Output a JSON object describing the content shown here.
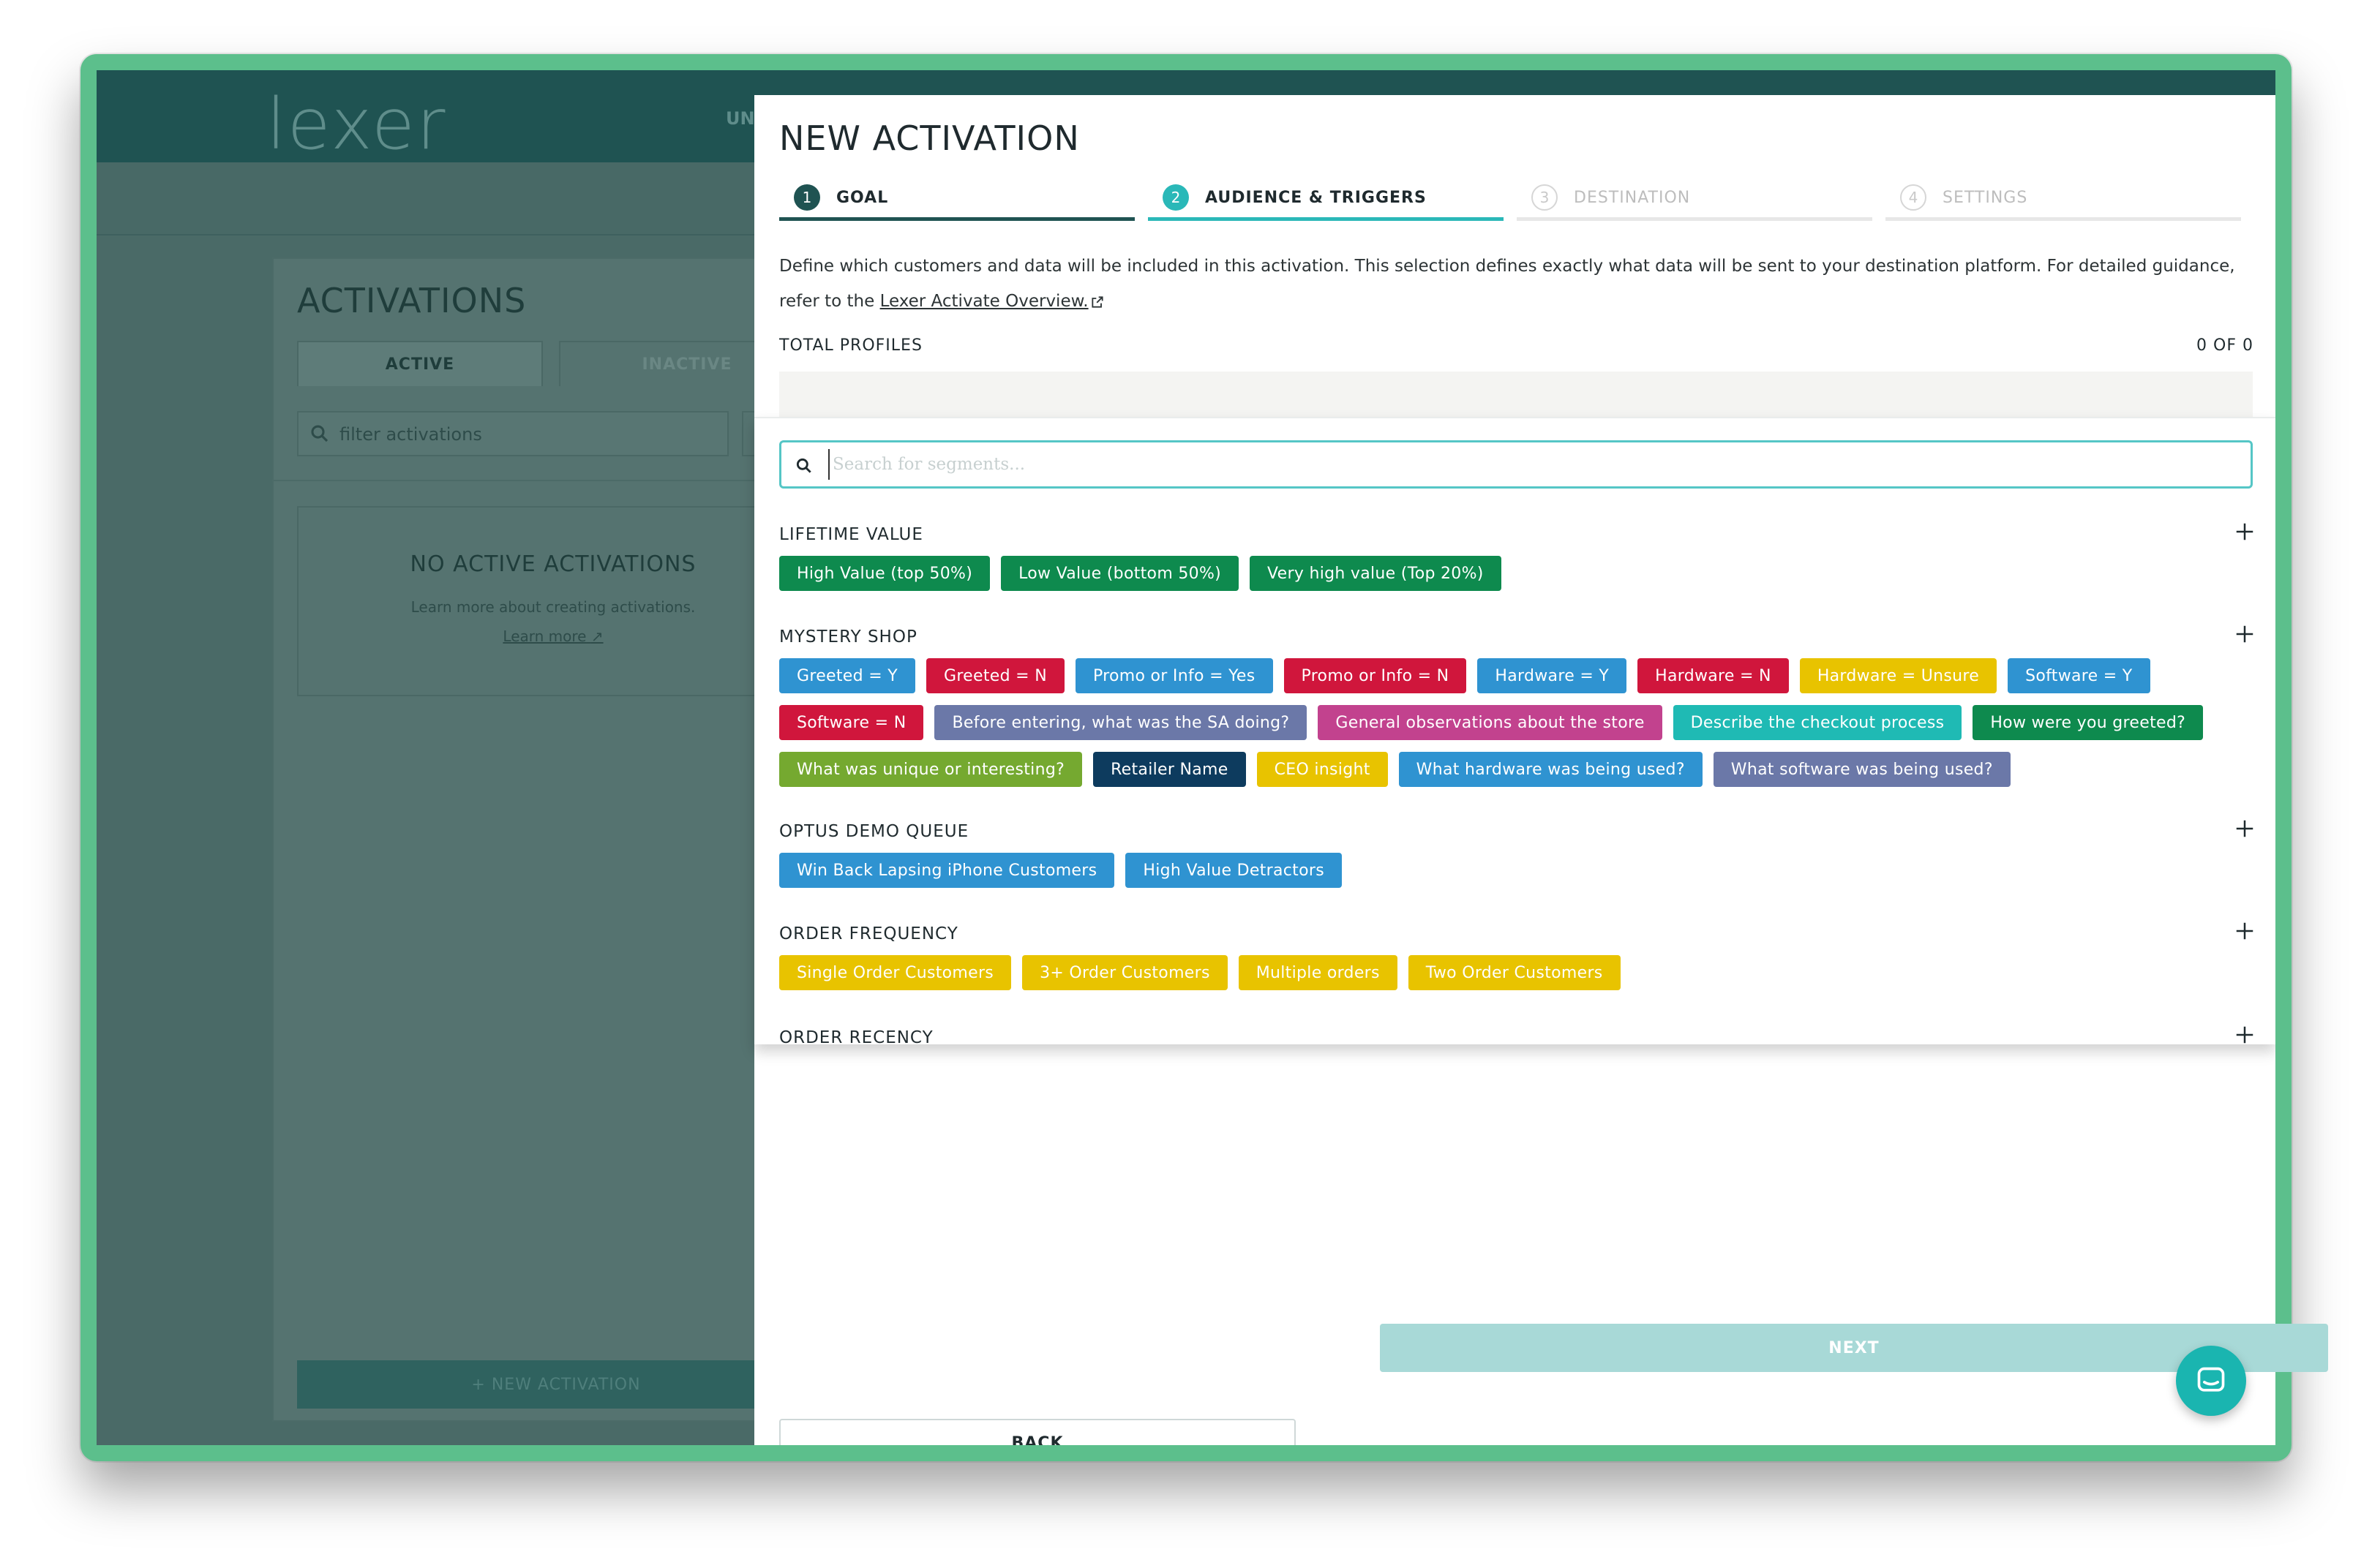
{
  "app": {
    "logo_text": "lexer",
    "header_peek": "UN",
    "panel_title": "ACTIVATIONS",
    "tabs": [
      "ACTIVE",
      "INACTIVE"
    ],
    "filter_placeholder": "filter activations",
    "empty_title": "NO ACTIVE ACTIVATIONS",
    "empty_subtitle": "Learn more about creating activations.",
    "empty_link": "Learn more",
    "new_activation_label": "+ NEW ACTIVATION"
  },
  "modal": {
    "title": "NEW ACTIVATION",
    "steps": [
      {
        "num": "1",
        "label": "GOAL"
      },
      {
        "num": "2",
        "label": "AUDIENCE & TRIGGERS"
      },
      {
        "num": "3",
        "label": "DESTINATION"
      },
      {
        "num": "4",
        "label": "SETTINGS"
      }
    ],
    "description": "Define which customers and data will be included in this activation. This selection defines exactly what data will be sent to your destination platform. For detailed guidance, refer to the",
    "description_link": "Lexer Activate Overview.",
    "total_profiles_label": "TOTAL PROFILES",
    "total_profiles_value": "0 OF 0",
    "search_placeholder": "Search for segments...",
    "groups": [
      {
        "title": "LIFETIME VALUE",
        "tags": [
          {
            "label": "High Value (top 50%)",
            "color": "#0e8a4e"
          },
          {
            "label": "Low Value (bottom 50%)",
            "color": "#0e8a4e"
          },
          {
            "label": "Very high value (Top 20%)",
            "color": "#0e8a4e"
          }
        ]
      },
      {
        "title": "MYSTERY SHOP",
        "tags": [
          {
            "label": "Greeted = Y",
            "color": "#2f93d1"
          },
          {
            "label": "Greeted = N",
            "color": "#d0163c"
          },
          {
            "label": "Promo or Info = Yes",
            "color": "#2f93d1"
          },
          {
            "label": "Promo or Info = N",
            "color": "#d0163c"
          },
          {
            "label": "Hardware = Y",
            "color": "#2f93d1"
          },
          {
            "label": "Hardware = N",
            "color": "#d0163c"
          },
          {
            "label": "Hardware = Unsure",
            "color": "#e8c300"
          },
          {
            "label": "Software = Y",
            "color": "#2f93d1"
          },
          {
            "label": "Software = N",
            "color": "#d0163c"
          },
          {
            "label": "Before entering, what was the SA doing?",
            "color": "#6b78a8"
          },
          {
            "label": "General observations about the store",
            "color": "#c2428e"
          },
          {
            "label": "Describe the checkout process",
            "color": "#1fbab4"
          },
          {
            "label": "How were you greeted?",
            "color": "#0e8a4e"
          },
          {
            "label": "What was unique or interesting?",
            "color": "#75a930"
          },
          {
            "label": "Retailer Name",
            "color": "#0d3b5e"
          },
          {
            "label": "CEO insight",
            "color": "#e8c300"
          },
          {
            "label": "What hardware was being used?",
            "color": "#2f93d1"
          },
          {
            "label": "What software was being used?",
            "color": "#6b78a8"
          }
        ]
      },
      {
        "title": "OPTUS DEMO QUEUE",
        "tags": [
          {
            "label": "Win Back Lapsing iPhone Customers",
            "color": "#2f93d1"
          },
          {
            "label": "High Value Detractors",
            "color": "#2f93d1"
          }
        ]
      },
      {
        "title": "ORDER FREQUENCY",
        "tags": [
          {
            "label": "Single Order Customers",
            "color": "#e8c300"
          },
          {
            "label": "3+ Order Customers",
            "color": "#e8c300"
          },
          {
            "label": "Multiple orders",
            "color": "#e8c300"
          },
          {
            "label": "Two Order Customers",
            "color": "#e8c300"
          }
        ]
      },
      {
        "title": "ORDER RECENCY",
        "tags": []
      }
    ],
    "back_label": "BACK",
    "next_label": "NEXT"
  },
  "colors": {
    "accent": "#2ab8b8",
    "brand_dark": "#1f5352",
    "frame": "#5cbf8c"
  }
}
